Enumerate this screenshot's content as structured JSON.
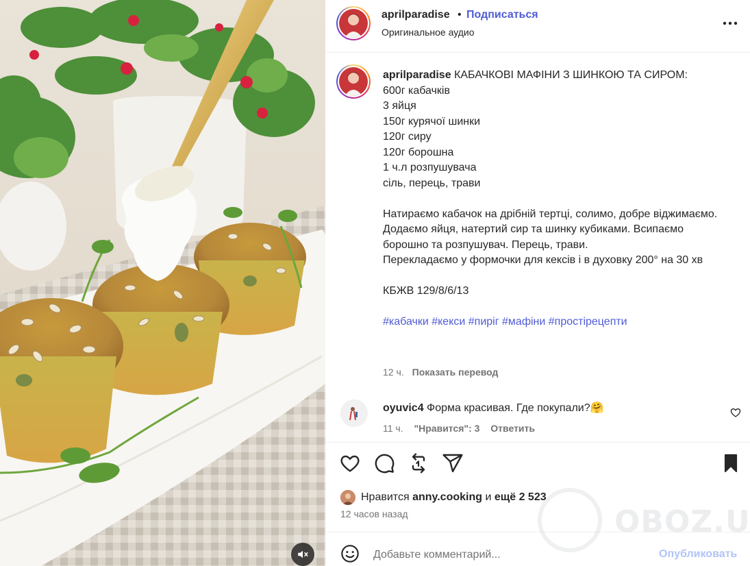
{
  "post": {
    "username": "aprilparadise",
    "follow_label": "Подписаться",
    "dot": "•",
    "audio_label": "Оригинальное аудио",
    "caption_title": "КАБАЧКОВІ МАФІНИ З ШИНКОЮ ТА СИРОМ:",
    "ingredients": [
      "600г кабачків",
      "3 яйця",
      "150г курячої шинки",
      "120г сиру",
      "120г борошна",
      "1 ч.л розпушувача",
      "сіль, перець, трави"
    ],
    "steps": [
      "Натираємо кабачок на дрібній тертці, солимо, добре віджимаємо.",
      "Додаємо яйця, натертий сир та шинку кубиками. Всипаємо борошно та розпушувач. Перець, трави.",
      "Перекладаємо у формочки для кексів і в духовку 200° на 30 хв"
    ],
    "nutrition": "КБЖВ 129/8/6/13",
    "hashtags": [
      "#кабачки",
      "#кекси",
      "#пиріг",
      "#мафіни",
      "#простірецепти"
    ],
    "caption_time": "12 ч.",
    "translate_label": "Показать перевод"
  },
  "comment": {
    "username": "oyuvic4",
    "text": "Форма красивая. Где покупали?🤗",
    "time": "11 ч.",
    "likes": "\"Нравится\": 3",
    "reply_label": "Ответить"
  },
  "actions": {
    "like_icon": "heart-icon",
    "comment_icon": "speech-bubble-icon",
    "share_icon": "repost-icon",
    "send_icon": "paper-plane-icon",
    "save_icon": "bookmark-icon"
  },
  "likes": {
    "prefix": "Нравится",
    "user": "anny.cooking",
    "middle": "и",
    "count": "ещё 2 523"
  },
  "posted_ago": "12 часов назад",
  "composer": {
    "placeholder": "Добавьте комментарий...",
    "publish_label": "Опубликовать"
  },
  "watermark": "OBOZ.UA",
  "colors": {
    "link_blue": "#4f5bd5",
    "publish_disabled": "#b2c4f7",
    "muted_text": "#737373"
  }
}
